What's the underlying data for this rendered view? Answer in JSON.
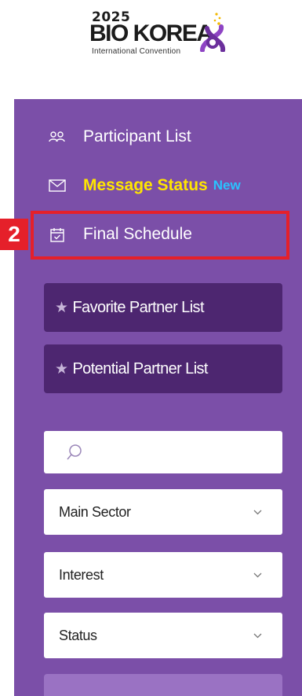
{
  "logo": {
    "year": "2025",
    "name": "BIO KOREA",
    "subtitle": "International Convention"
  },
  "nav": {
    "participant_list": "Participant List",
    "message_status": "Message Status",
    "message_badge": "New",
    "final_schedule": "Final Schedule"
  },
  "annotation": {
    "number": "2",
    "color": "#e5202a"
  },
  "partners": {
    "favorite": "Favorite Partner List",
    "potential": "Potential Partner List",
    "star": "★"
  },
  "search": {
    "placeholder": ""
  },
  "filters": {
    "main_sector": "Main Sector",
    "interest": "Interest",
    "status": "Status"
  },
  "colors": {
    "panel": "#7b4fa8",
    "button_dark": "#4d2670",
    "highlight_text": "#ffe600",
    "badge_text": "#29c3ff"
  }
}
